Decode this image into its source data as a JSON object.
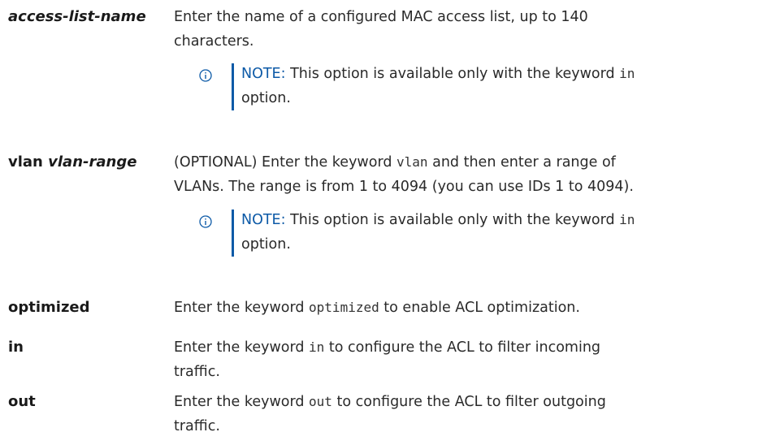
{
  "colors": {
    "note_accent": "#0d5aa7",
    "text": "#1a1a1a"
  },
  "rows": [
    {
      "term": {
        "bold": "",
        "italic": "access-list-name"
      },
      "desc": {
        "line1": "Enter the name of a configured MAC access list, up to 140",
        "line2": "characters."
      },
      "note": {
        "icon": "info-icon",
        "label": "NOTE:",
        "pre": " This option is available only with the keyword ",
        "code": "in",
        "line2": "option."
      }
    },
    {
      "term": {
        "bold": "vlan ",
        "italic": "vlan-range"
      },
      "desc": {
        "pre": "(OPTIONAL) Enter the keyword ",
        "code": "vlan",
        "post": " and then enter a range of",
        "line2": "VLANs. The range is from 1 to 4094 (you can use IDs 1 to 4094)."
      },
      "note": {
        "icon": "info-icon",
        "label": "NOTE:",
        "pre": " This option is available only with the keyword ",
        "code": "in",
        "line2": "option."
      }
    },
    {
      "term": {
        "bold": "optimized"
      },
      "desc": {
        "pre": "Enter the keyword ",
        "code": "optimized",
        "post": " to enable ACL optimization."
      }
    },
    {
      "term": {
        "bold": "in"
      },
      "desc": {
        "pre": "Enter the keyword ",
        "code": "in",
        "post": " to configure the ACL to filter incoming",
        "line2": "traffic."
      }
    },
    {
      "term": {
        "bold": "out"
      },
      "desc": {
        "pre": "Enter the keyword ",
        "code": "out",
        "post": " to configure the ACL to filter outgoing",
        "line2": "traffic."
      }
    }
  ]
}
